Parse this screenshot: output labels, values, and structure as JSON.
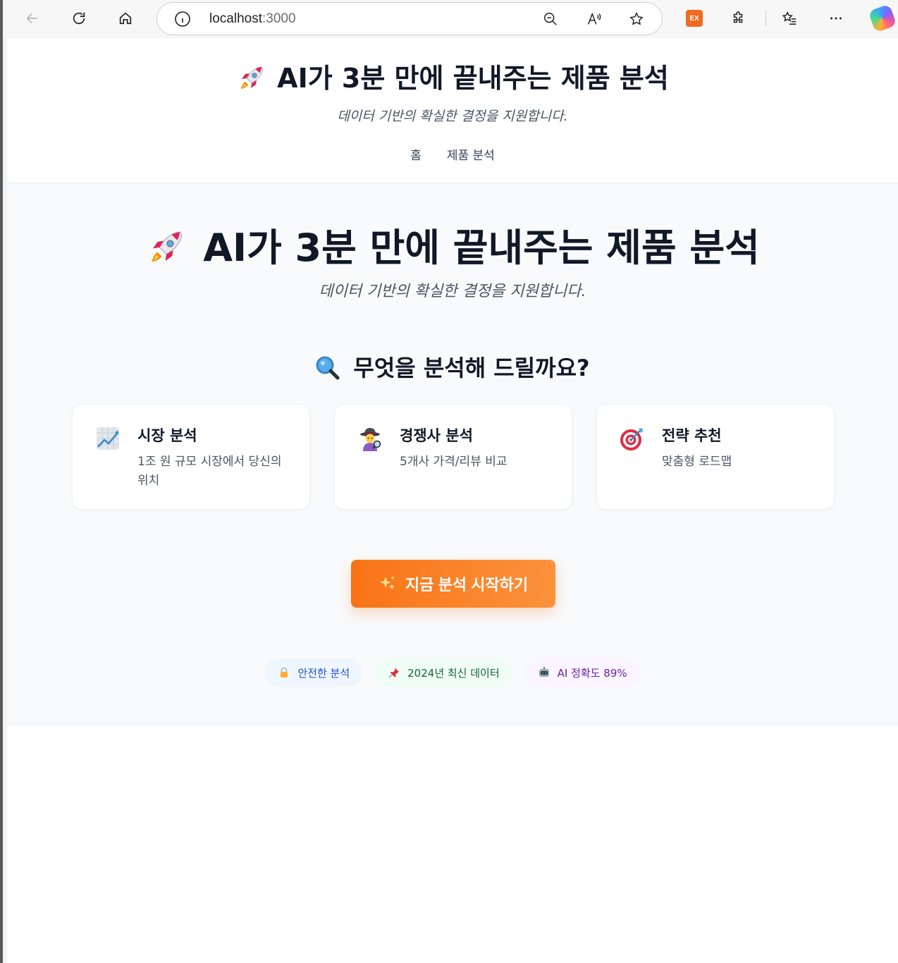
{
  "browser": {
    "url_host": "localhost",
    "url_port": ":3000",
    "ex_badge": "EX"
  },
  "header": {
    "title": "AI가 3분 만에 끝내주는 제품 분석",
    "subtitle": "데이터 기반의 확실한 결정을 지원합니다.",
    "nav": [
      "홈",
      "제품 분석"
    ]
  },
  "hero": {
    "title": "AI가 3분 만에 끝내주는 제품 분석",
    "subtitle": "데이터 기반의 확실한 결정을 지원합니다."
  },
  "question": {
    "title": "무엇을 분석해 드릴까요?",
    "icon": "magnifier-icon"
  },
  "cards": [
    {
      "title": "시장 분석",
      "desc": "1조 원 규모 시장에서 당신의 위치",
      "icon": "chart-icon"
    },
    {
      "title": "경쟁사 분석",
      "desc": "5개사 가격/리뷰 비교",
      "icon": "detective-icon"
    },
    {
      "title": "전략 추천",
      "desc": "맞춤형 로드맵",
      "icon": "target-icon"
    }
  ],
  "cta": {
    "label": "지금 분석 시작하기",
    "icon": "sparkles-icon",
    "color": "#f97316"
  },
  "badges": [
    {
      "label": "안전한 분석",
      "icon": "lock-icon"
    },
    {
      "label": "2024년 최신 데이터",
      "icon": "pin-icon"
    },
    {
      "label": "AI 정확도 89%",
      "icon": "robot-icon"
    }
  ]
}
